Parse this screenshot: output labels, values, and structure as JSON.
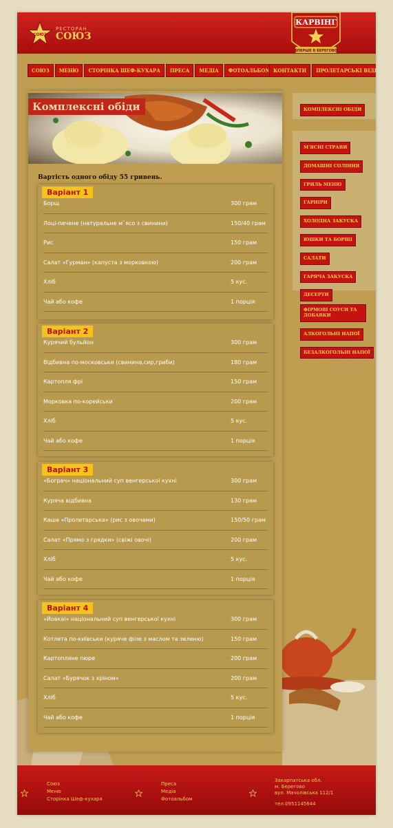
{
  "header": {
    "logo_small": "РЕСТОРАН",
    "logo_big": "СОЮЗ",
    "logo_star_text": "СОЮЗ",
    "badge_title": "КАРВІНГ",
    "badge_sub": "ВПЕРШЕ В БЕРЕГОВО"
  },
  "nav": {
    "left": [
      "СОЮЗ",
      "МЕНЮ",
      "СТОРІНКА ШЕФ-КУХАРА",
      "ПРЕСА",
      "МЕДІА",
      "ФОТОАЛЬБОМ"
    ],
    "right": [
      "КОНТАКТИ",
      "ПРОЛЕТАРСЬКІ ВІДГУКИ"
    ]
  },
  "page": {
    "title": "Комплексні обіди",
    "price_text": "Вартість одного обіду 55 гривень."
  },
  "variants": [
    {
      "label": "Варіант 1",
      "items": [
        {
          "dish": "Борщ",
          "amount": "300 грам"
        },
        {
          "dish": "Лоці-печене (натуральне м`ясо з свинини)",
          "amount": "150/40 грам"
        },
        {
          "dish": "Рис",
          "amount": "150 грам"
        },
        {
          "dish": "Салат «Гурман» (капуста з морковкою)",
          "amount": "200 грам"
        },
        {
          "dish": "Хліб",
          "amount": "5 кус."
        },
        {
          "dish": "Чай або кофе",
          "amount": "1 порція"
        }
      ]
    },
    {
      "label": "Варіант 2",
      "items": [
        {
          "dish": "Курячий бульйон",
          "amount": "300 грам"
        },
        {
          "dish": "Відбивна по-московськи (свинина,сир,гриби)",
          "amount": "180 грам"
        },
        {
          "dish": "Картопля фрі",
          "amount": "150 грам"
        },
        {
          "dish": "Морковка по-корейськи",
          "amount": "200 грам"
        },
        {
          "dish": "Хліб",
          "amount": "5 кус."
        },
        {
          "dish": "Чай або кофе",
          "amount": "1 порція"
        }
      ]
    },
    {
      "label": "Варіант 3",
      "items": [
        {
          "dish": "«Бограч» національний суп венгерської кухні",
          "amount": "300 грам"
        },
        {
          "dish": "Куряча відбивна",
          "amount": "130 грам"
        },
        {
          "dish": "Каша «Пролетарська» (рис з овочами)",
          "amount": "150/50 грам"
        },
        {
          "dish": "Салат «Прямо з грядки» (свіжі овочі)",
          "amount": "200 грам"
        },
        {
          "dish": "Хліб",
          "amount": "5 кус."
        },
        {
          "dish": "Чай або кофе",
          "amount": "1 порція"
        }
      ]
    },
    {
      "label": "Варіант 4",
      "items": [
        {
          "dish": "«Йовкаі» національний суп венгерської кухні",
          "amount": "300 грам"
        },
        {
          "dish": "Котлета по-київськи (куряче філе з маслом та зеленю)",
          "amount": "150 грам"
        },
        {
          "dish": "Картопляне пюре",
          "amount": "200 грам"
        },
        {
          "dish": "Салат «Бурячок з хріном»",
          "amount": "200 грам"
        },
        {
          "dish": "Хліб",
          "amount": "5 кус."
        },
        {
          "dish": "Чай або кофе",
          "amount": "1 порція"
        }
      ]
    }
  ],
  "sidebar": {
    "top": "КОМПЛЕКСНІ ОБІДИ",
    "items": [
      "М'ЯСНІ СТРАВИ",
      "ДОМАШНІ СОЛІННЯ",
      "ГРИЛЬ МЕНЮ",
      "ГАРНІРИ",
      "ХОЛОДНА ЗАКУСКА",
      "ЮШКИ ТА БОРЩІ",
      "САЛАТИ",
      "ГАРЯЧА ЗАКУСКА",
      "ДЕСЕРТИ",
      "ФІРМОВІ СОУСИ ТА ДОБАВКИ",
      "АЛКОГОЛЬНІ НАПОЇ",
      "БЕЗАЛКОГОЛЬНІ НАПОЇ"
    ]
  },
  "footer": {
    "col1": [
      "Союз",
      "Меню",
      "Сторінка Шеф-кухаря"
    ],
    "col2": [
      "Преса",
      "Медіа",
      "Фотоальбом"
    ],
    "address": [
      "Закарпатська обл.",
      "м. Берегово",
      "вул. Мачолівська 112/1"
    ],
    "phone": "тел.0951145644"
  },
  "colors": {
    "accent_red": "#c51410",
    "nav_text": "#f6d24a",
    "label_yellow": "#f7c21b",
    "panel": "#bf9e52"
  }
}
